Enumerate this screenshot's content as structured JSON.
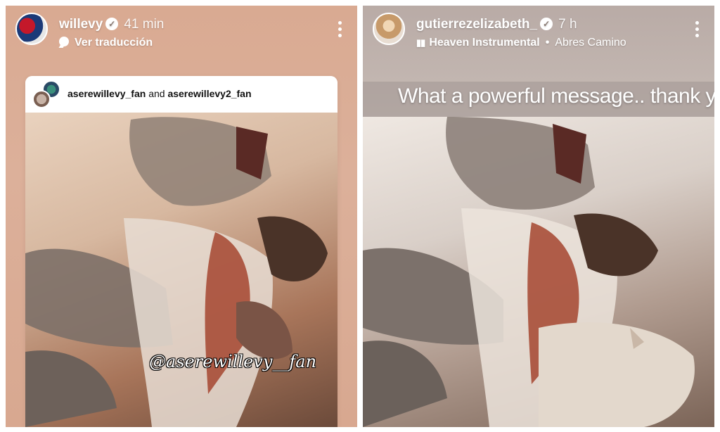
{
  "left_story": {
    "username": "willevy",
    "time": "41 min",
    "subtitle": "Ver traducción",
    "shared_post": {
      "title_user1": "aserewillevy_fan",
      "title_joiner": "and",
      "title_user2": "aserewillevy2_fan",
      "watermark": "@aserewillevy__fan"
    }
  },
  "right_story": {
    "username": "gutierrezelizabeth_",
    "time": "7 h",
    "song": "Heaven Instrumental",
    "separator": "•",
    "artist": "Abres Camino",
    "caption": "What a powerful message.. thank you"
  },
  "icons": {
    "verified": "verified-badge-icon",
    "more": "more-vertical-icon",
    "translate": "translate-bubble-icon",
    "music": "music-bars-icon"
  },
  "colors": {
    "left_background": "#d9aa92",
    "right_background": "#c8bdb7",
    "text": "#ffffff"
  }
}
